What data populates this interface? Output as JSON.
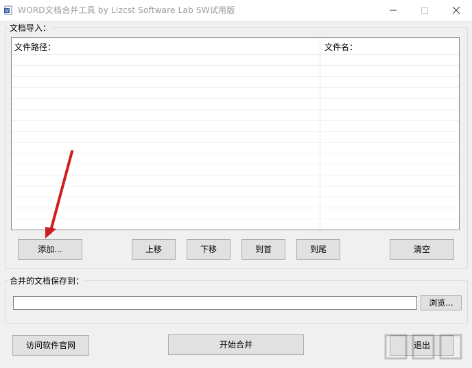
{
  "window": {
    "title": "WORD文档合并工具   by Lizcst Software Lab   SW试用版",
    "icon": "word-app-icon",
    "controls": [
      "minimize-icon",
      "maximize-icon",
      "close-icon"
    ]
  },
  "import_group": {
    "label": "文档导入：",
    "columns": [
      {
        "label": "文件路径："
      },
      {
        "label": "文件名："
      }
    ],
    "rows": []
  },
  "buttons": {
    "add": "添加...",
    "move_up": "上移",
    "move_down": "下移",
    "to_top": "到首",
    "to_bottom": "到尾",
    "clear": "清空"
  },
  "save_group": {
    "label": "合并的文档保存到：",
    "path_value": "",
    "browse": "浏览..."
  },
  "footer": {
    "visit_site": "访问软件官网",
    "start_merge": "开始合并",
    "exit": "退出"
  },
  "colors": {
    "annotation_arrow": "#cc1f1f",
    "button_face": "#e1e1e1",
    "window_bg": "#f0f0f0"
  }
}
